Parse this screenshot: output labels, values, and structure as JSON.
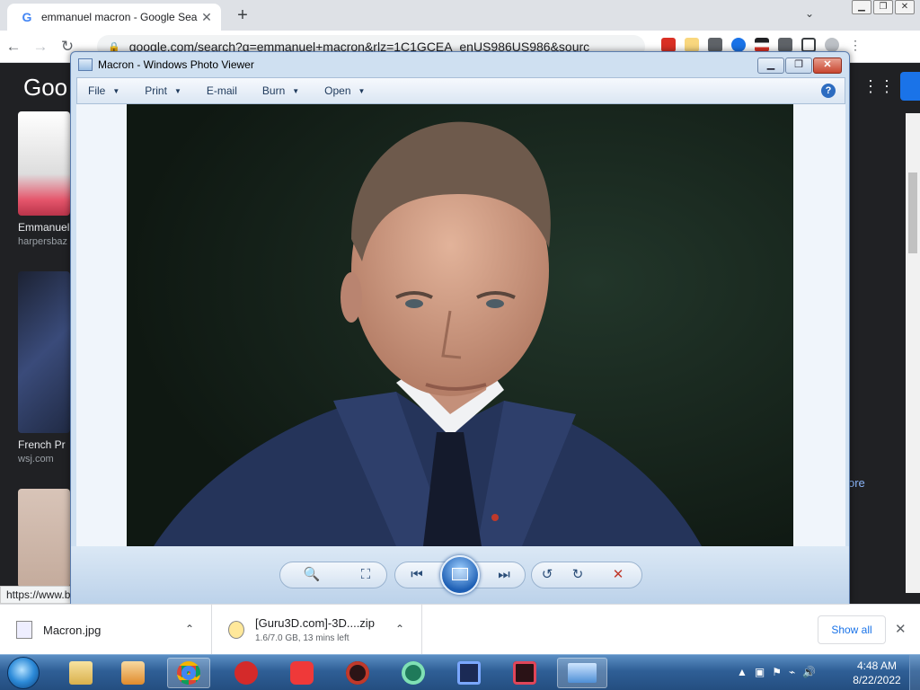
{
  "browser": {
    "tab_title": "emmanuel macron - Google Sea",
    "tab_close": "✕",
    "new_tab": "+",
    "tab_search": "⌄",
    "url": "google.com/search?q=emmanuel+macron&rlz=1C1GCEA_enUS986US986&sourc",
    "status_url": "https://www.b"
  },
  "google_page": {
    "logo": "Goo",
    "results": [
      {
        "title": "Emmanuel",
        "source": "harpersbaz"
      },
      {
        "title": "French Pr",
        "source": "wsj.com"
      }
    ],
    "more_link": "ore"
  },
  "photo_viewer": {
    "title": "Macron - Windows Photo Viewer",
    "min": "▁",
    "max": "❐",
    "close": "✕",
    "help": "?",
    "menu": [
      {
        "label": "File",
        "dropdown": true
      },
      {
        "label": "Print",
        "dropdown": true
      },
      {
        "label": "E-mail",
        "dropdown": false
      },
      {
        "label": "Burn",
        "dropdown": true
      },
      {
        "label": "Open",
        "dropdown": true
      }
    ],
    "caret": "▼"
  },
  "downloads": {
    "items": [
      {
        "name": "Macron.jpg",
        "sub": ""
      },
      {
        "name": "[Guru3D.com]-3D....zip",
        "sub": "1.6/7.0 GB, 13 mins left"
      }
    ],
    "show_all": "Show all",
    "close": "✕",
    "caret": "⌃"
  },
  "taskbar": {
    "time": "4:48 AM",
    "date": "8/22/2022",
    "tray_glyphs": [
      "▲",
      "▣",
      "⚑",
      "⌁",
      "🔊"
    ]
  },
  "colors": {
    "chrome_tabstrip": "#dee1e6",
    "google_dark": "#202124",
    "viewer_frame": "#cfe0f1",
    "taskbar_blue": "#2f5f96",
    "link_blue": "#1a73e8"
  }
}
